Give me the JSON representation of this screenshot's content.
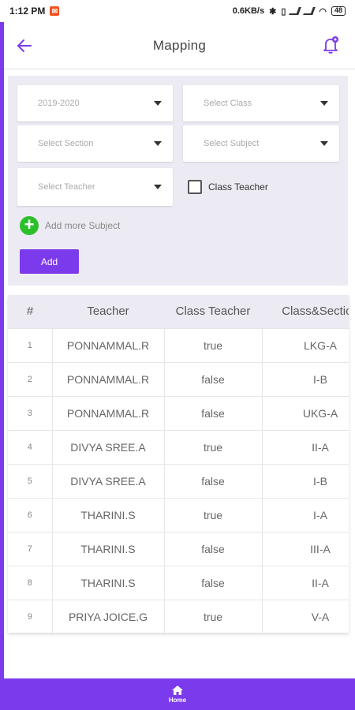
{
  "statusbar": {
    "time": "1:12 PM",
    "speed": "0.6KB/s",
    "battery": "48"
  },
  "appbar": {
    "title": "Mapping"
  },
  "form": {
    "year": "2019-2020",
    "class_placeholder": "Select Class",
    "section_placeholder": "Select Section",
    "subject_placeholder": "Select Subject",
    "teacher_placeholder": "Select Teacher",
    "class_teacher_label": "Class Teacher",
    "add_more_label": "Add more Subject",
    "add_button": "Add"
  },
  "table": {
    "headers": [
      "#",
      "Teacher",
      "Class Teacher",
      "Class&Section"
    ],
    "rows": [
      [
        "1",
        "PONNAMMAL.R",
        "true",
        "LKG-A"
      ],
      [
        "2",
        "PONNAMMAL.R",
        "false",
        "I-B"
      ],
      [
        "3",
        "PONNAMMAL.R",
        "false",
        "UKG-A"
      ],
      [
        "4",
        "DIVYA SREE.A",
        "true",
        "II-A"
      ],
      [
        "5",
        "DIVYA SREE.A",
        "false",
        "I-B"
      ],
      [
        "6",
        "THARINI.S",
        "true",
        "I-A"
      ],
      [
        "7",
        "THARINI.S",
        "false",
        "III-A"
      ],
      [
        "8",
        "THARINI.S",
        "false",
        "II-A"
      ],
      [
        "9",
        "PRIYA JOICE.G",
        "true",
        "V-A"
      ]
    ]
  },
  "bottomnav": {
    "home_label": "Home"
  },
  "colors": {
    "accent": "#7c3aed",
    "add_green": "#2cbf2c"
  }
}
